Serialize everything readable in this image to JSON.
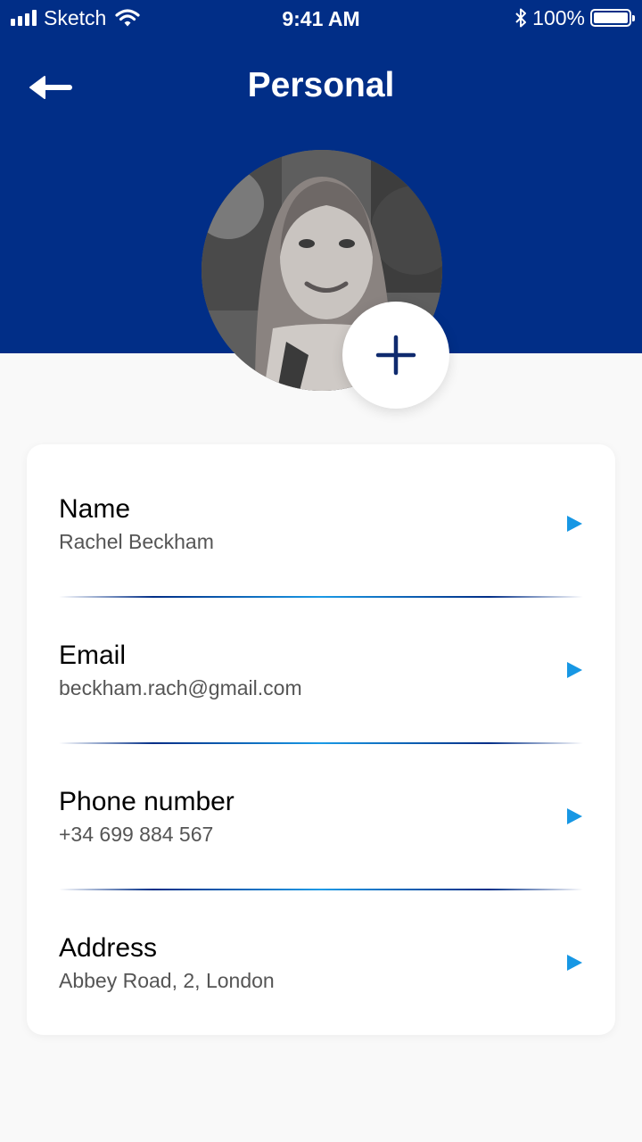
{
  "status_bar": {
    "carrier": "Sketch",
    "time": "9:41 AM",
    "battery_percent": "100%",
    "battery_level": 1.0,
    "icons": [
      "signal-icon",
      "wifi-icon",
      "bluetooth-icon",
      "battery-icon"
    ]
  },
  "header": {
    "title": "Personal",
    "back_icon": "arrow-left-icon",
    "background_color": "#012e87"
  },
  "profile": {
    "add_photo_icon": "plus-icon"
  },
  "fields": [
    {
      "label": "Name",
      "value": "Rachel Beckham"
    },
    {
      "label": "Email",
      "value": "beckham.rach@gmail.com"
    },
    {
      "label": "Phone number",
      "value": "+34 699 884 567"
    },
    {
      "label": "Address",
      "value": "Abbey Road, 2, London"
    }
  ],
  "colors": {
    "accent": "#1797e4",
    "brand_dark": "#012e87"
  }
}
